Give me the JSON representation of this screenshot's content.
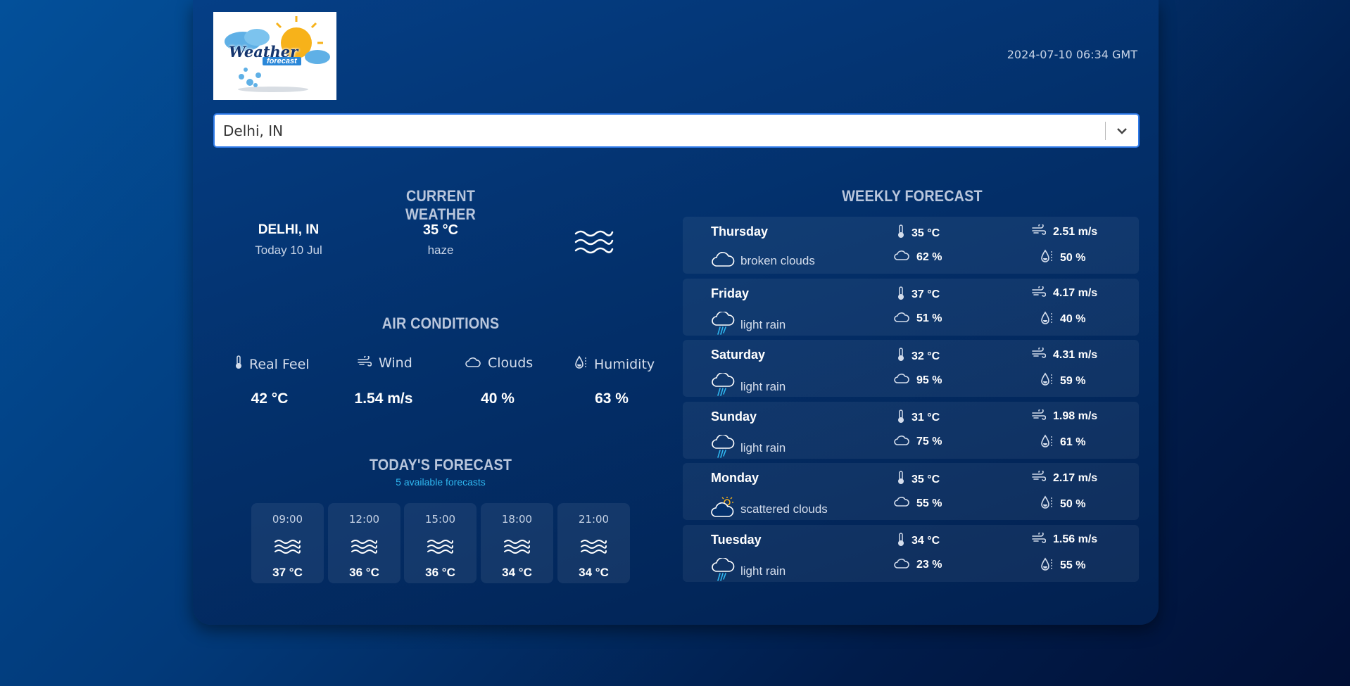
{
  "header": {
    "logo_text": "Weather",
    "logo_subtext": "forecast",
    "timestamp": "2024-07-10 06:34 GMT"
  },
  "search": {
    "value": "Delhi, IN",
    "icon": "chevron-down-icon"
  },
  "current_weather": {
    "title": "CURRENT WEATHER",
    "city": "DELHI, IN",
    "date": "Today 10 Jul",
    "temperature": "35 °C",
    "description": "haze",
    "icon": "haze-icon"
  },
  "air_conditions": {
    "title": "AIR CONDITIONS",
    "items": [
      {
        "label": "Real Feel",
        "value": "42 °C",
        "icon": "thermometer-icon"
      },
      {
        "label": "Wind",
        "value": "1.54 m/s",
        "icon": "wind-icon"
      },
      {
        "label": "Clouds",
        "value": "40 %",
        "icon": "cloud-icon"
      },
      {
        "label": "Humidity",
        "value": "63 %",
        "icon": "humidity-icon"
      }
    ]
  },
  "todays_forecast": {
    "title": "TODAY'S FORECAST",
    "subtitle": "5 available forecasts",
    "hours": [
      {
        "time": "09:00",
        "temp": "37 °C",
        "icon": "haze-icon"
      },
      {
        "time": "12:00",
        "temp": "36 °C",
        "icon": "haze-icon"
      },
      {
        "time": "15:00",
        "temp": "36 °C",
        "icon": "haze-icon"
      },
      {
        "time": "18:00",
        "temp": "34 °C",
        "icon": "haze-icon"
      },
      {
        "time": "21:00",
        "temp": "34 °C",
        "icon": "haze-icon"
      }
    ]
  },
  "weekly_forecast": {
    "title": "WEEKLY FORECAST",
    "days": [
      {
        "day": "Thursday",
        "desc": "broken clouds",
        "icon": "broken-clouds-icon",
        "temp": "35 °C",
        "wind": "2.51 m/s",
        "clouds": "62 %",
        "humidity": "50 %"
      },
      {
        "day": "Friday",
        "desc": "light rain",
        "icon": "light-rain-icon",
        "temp": "37 °C",
        "wind": "4.17 m/s",
        "clouds": "51 %",
        "humidity": "40 %"
      },
      {
        "day": "Saturday",
        "desc": "light rain",
        "icon": "light-rain-icon",
        "temp": "32 °C",
        "wind": "4.31 m/s",
        "clouds": "95 %",
        "humidity": "59 %"
      },
      {
        "day": "Sunday",
        "desc": "light rain",
        "icon": "light-rain-icon",
        "temp": "31 °C",
        "wind": "1.98 m/s",
        "clouds": "75 %",
        "humidity": "61 %"
      },
      {
        "day": "Monday",
        "desc": "scattered clouds",
        "icon": "scattered-clouds-icon",
        "temp": "35 °C",
        "wind": "2.17 m/s",
        "clouds": "55 %",
        "humidity": "50 %"
      },
      {
        "day": "Tuesday",
        "desc": "light rain",
        "icon": "light-rain-icon",
        "temp": "34 °C",
        "wind": "1.56 m/s",
        "clouds": "23 %",
        "humidity": "55 %"
      }
    ]
  }
}
